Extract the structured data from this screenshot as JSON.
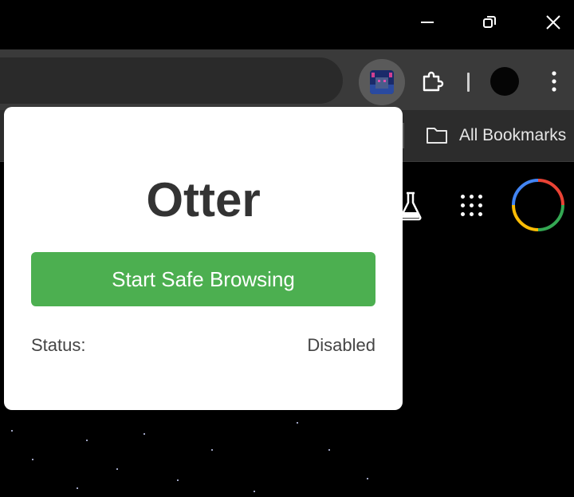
{
  "window": {
    "minimize_label": "Minimize",
    "restore_label": "Restore",
    "close_label": "Close"
  },
  "toolbar": {
    "extension_icon": "otter-extension-icon",
    "extensions_icon": "puzzle-icon",
    "profile_icon": "profile-avatar",
    "menu_icon": "more-vert-icon"
  },
  "bookmarks": {
    "all_bookmarks_label": "All Bookmarks",
    "folder_icon": "folder-icon"
  },
  "popup": {
    "title": "Otter",
    "start_button_label": "Start Safe Browsing",
    "status_label": "Status:",
    "status_value": "Disabled",
    "accent_color": "#4caf50"
  },
  "newtab": {
    "labs_icon": "flask-icon",
    "apps_icon": "apps-grid-icon",
    "account_icon": "google-account-ring"
  }
}
